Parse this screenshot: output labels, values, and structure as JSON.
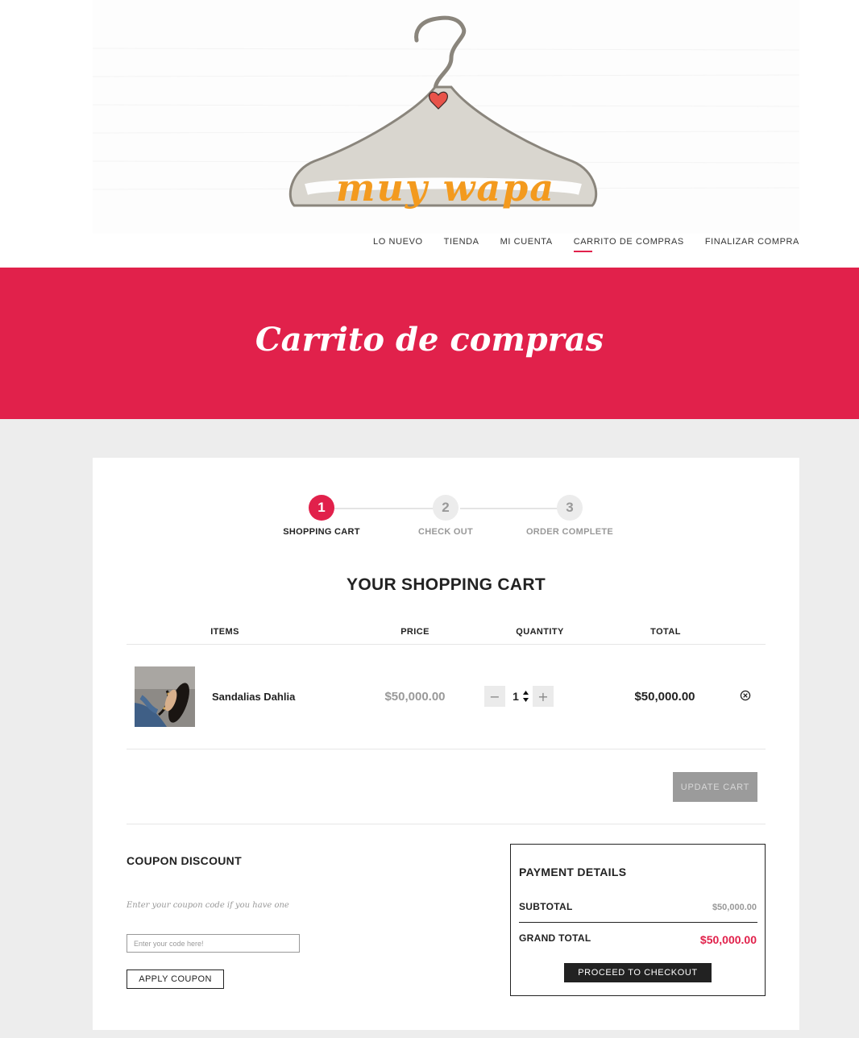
{
  "brand": {
    "logo_text": "muy wapa"
  },
  "nav": {
    "items": [
      {
        "label": "LO NUEVO"
      },
      {
        "label": "TIENDA"
      },
      {
        "label": "MI CUENTA"
      },
      {
        "label": "CARRITO DE COMPRAS",
        "active": true
      },
      {
        "label": "FINALIZAR COMPRA"
      }
    ]
  },
  "banner": {
    "title": "Carrito de compras"
  },
  "steps": [
    {
      "number": "1",
      "label": "SHOPPING CART",
      "active": true
    },
    {
      "number": "2",
      "label": "CHECK OUT"
    },
    {
      "number": "3",
      "label": "ORDER COMPLETE"
    }
  ],
  "cart": {
    "title": "YOUR SHOPPING CART",
    "columns": {
      "items": "ITEMS",
      "price": "PRICE",
      "quantity": "QUANTITY",
      "total": "TOTAL"
    },
    "rows": [
      {
        "name": "Sandalias Dahlia",
        "price": "$50,000.00",
        "quantity": "1",
        "total": "$50,000.00",
        "remove_icon": "circle-x-icon"
      }
    ],
    "update_label": "UPDATE CART"
  },
  "coupon": {
    "title": "COUPON DISCOUNT",
    "hint": "Enter your coupon code if you have one",
    "placeholder": "Enter your code here!",
    "apply_label": "APPLY COUPON"
  },
  "payment": {
    "title": "PAYMENT DETAILS",
    "subtotal_label": "SUBTOTAL",
    "subtotal_value": "$50,000.00",
    "grand_total_label": "GRAND TOTAL",
    "grand_total_value": "$50,000.00",
    "checkout_label": "PROCEED TO CHECKOUT"
  },
  "colors": {
    "accent": "#e1214b",
    "dark": "#222222",
    "muted": "#999999",
    "logo_orange": "#f39a1e"
  }
}
